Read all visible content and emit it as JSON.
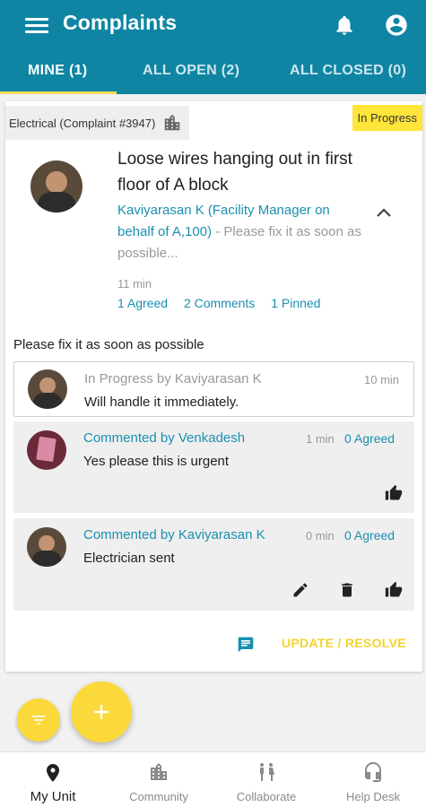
{
  "app": {
    "title": "Complaints"
  },
  "tabs": [
    {
      "label": "MINE (1)"
    },
    {
      "label": "ALL OPEN (2)"
    },
    {
      "label": "ALL CLOSED (0)"
    }
  ],
  "complaint": {
    "category": "Electrical (Complaint #3947)",
    "status": "In Progress",
    "title": "Loose wires hanging out in first floor of A block",
    "author": "Kaviyarasan K (Facility Manager on behalf of A,100)",
    "preview": " - Please fix it as soon as possible...",
    "time": "11 min",
    "agreed": "1 Agreed",
    "comments": "2 Comments",
    "pinned": "1 Pinned",
    "description": "Please fix it as soon as possible"
  },
  "timeline": [
    {
      "header": "In Progress by Kaviyarasan K",
      "body": "Will handle it immediately.",
      "time": "10 min"
    },
    {
      "header": "Commented by Venkadesh",
      "body": "Yes please this is urgent",
      "time": "1 min",
      "agreed": "0 Agreed"
    },
    {
      "header": "Commented by Kaviyarasan K",
      "body": "Electrician sent",
      "time": "0 min",
      "agreed": "0 Agreed"
    }
  ],
  "actions": {
    "update_label": "UPDATE / RESOLVE"
  },
  "bottom_nav": [
    {
      "label": "My Unit",
      "icon": "location-pin-icon"
    },
    {
      "label": "Community",
      "icon": "buildings-icon"
    },
    {
      "label": "Collaborate",
      "icon": "people-icon"
    },
    {
      "label": "Help Desk",
      "icon": "headset-icon"
    }
  ],
  "colors": {
    "primary": "#0f85a3",
    "accent": "#fcd93a",
    "link": "#1a8fb0",
    "badge": "#ffe53a"
  }
}
